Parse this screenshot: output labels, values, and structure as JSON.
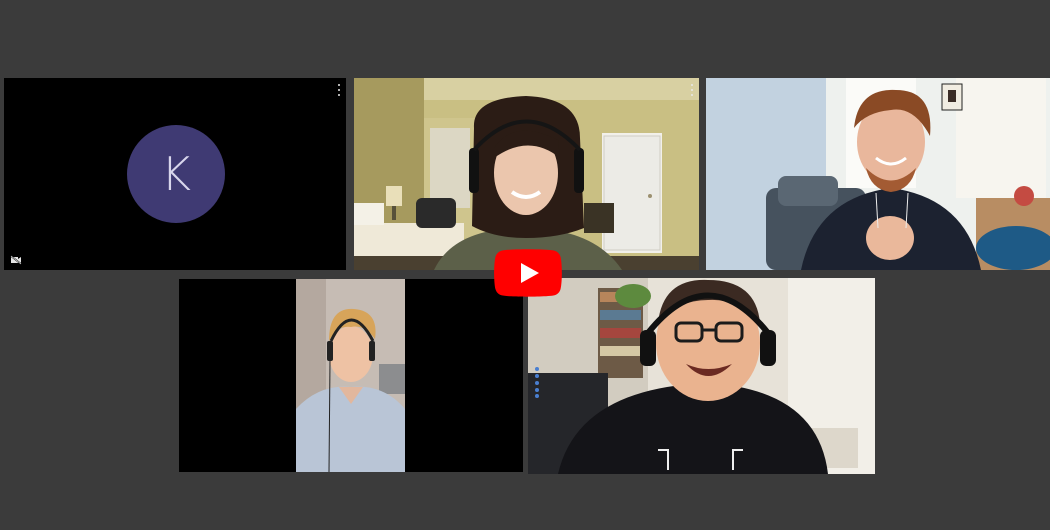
{
  "meeting": {
    "participants": [
      {
        "id": "p1",
        "initial": "K",
        "camera": "off",
        "avatar_color": "#3f3a73"
      },
      {
        "id": "p2",
        "camera": "on"
      },
      {
        "id": "p3",
        "camera": "on"
      },
      {
        "id": "p4",
        "camera": "on"
      },
      {
        "id": "p5",
        "camera": "on",
        "active_speaker": true
      }
    ]
  },
  "player": {
    "play_button_color": "#ff0000"
  },
  "colors": {
    "background": "#3b3b3b",
    "active_speaker_border": "#4a6fb3"
  }
}
